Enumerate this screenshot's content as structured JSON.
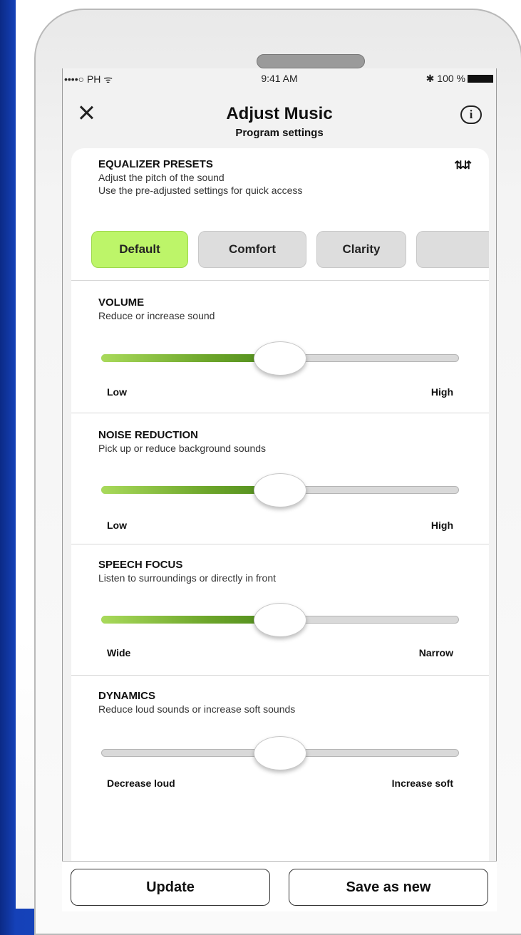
{
  "status_bar": {
    "carrier": "••••○ PH ᯤ",
    "time": "9:41 AM",
    "battery": "✱ 100 %"
  },
  "header": {
    "title": "Adjust Music",
    "subtitle": "Program settings",
    "info_icon_char": "i"
  },
  "equalizer": {
    "title": "EQUALIZER PRESETS",
    "desc_line1": "Adjust the pitch of the sound",
    "desc_line2": "Use the pre-adjusted settings for quick access",
    "sort_icon": "⇅⇵",
    "presets": [
      "Default",
      "Comfort",
      "Clarity",
      ""
    ],
    "active_preset": "Default"
  },
  "volume": {
    "title": "VOLUME",
    "desc": "Reduce or increase sound",
    "min_label": "Low",
    "max_label": "High",
    "level_percent": 50,
    "filled": true
  },
  "noise_reduction": {
    "title": "NOISE REDUCTION",
    "desc": "Pick up or reduce background sounds",
    "min_label": "Low",
    "max_label": "High",
    "level_percent": 50,
    "filled": true
  },
  "speech_focus": {
    "title": "SPEECH FOCUS",
    "desc": "Listen to surroundings or directly in front",
    "min_label": "Wide",
    "max_label": "Narrow",
    "level_percent": 50,
    "filled": true
  },
  "dynamics": {
    "title": "DYNAMICS",
    "desc": "Reduce loud sounds or increase soft sounds",
    "min_label": "Decrease loud",
    "max_label": "Increase soft",
    "level_percent": 50,
    "filled": false
  },
  "actions": {
    "update_label": "Update",
    "save_label": "Save as new"
  },
  "colors": {
    "accent_green": "#bdf569",
    "slider_green": "#6ca52a",
    "background_blue": "#1a4cc9"
  }
}
